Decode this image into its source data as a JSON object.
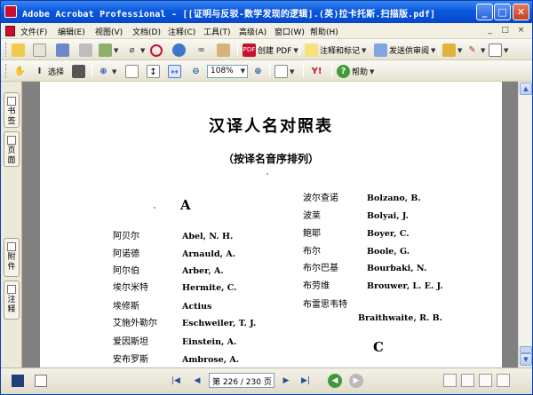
{
  "window": {
    "title": "Adobe Acrobat Professional - [[证明与反驳-数学发现的逻辑].(英)拉卡托斯.扫描版.pdf]",
    "controls": {
      "minimize": "_",
      "maximize": "□",
      "close": "✕"
    }
  },
  "menu": {
    "items": [
      "文件(F)",
      "编辑(E)",
      "视图(V)",
      "文档(D)",
      "注释(C)",
      "工具(T)",
      "高级(A)",
      "窗口(W)",
      "帮助(H)"
    ],
    "doc_controls": [
      "_",
      "□",
      "×"
    ]
  },
  "toolbar1": {
    "create_pdf": "创建 PDF",
    "comment_markup": "注释和标记",
    "send_review": "发送供审阅"
  },
  "toolbar2": {
    "select": "选择",
    "zoom_value": "108%",
    "help": "帮助"
  },
  "sidetabs": [
    "书签",
    "页面",
    "附件",
    "注释"
  ],
  "document": {
    "title": "汉译人名对照表",
    "subtitle": "（按译名音序排列）",
    "section_a": "A",
    "section_c": "C",
    "left_entries": [
      {
        "zh": "阿贝尔",
        "en": "Abel, N. H."
      },
      {
        "zh": "阿诺德",
        "en": "Arnauld, A."
      },
      {
        "zh": "阿尔伯",
        "en": "Arber, A."
      },
      {
        "zh": "埃尔米特",
        "en": "Hermite, C."
      },
      {
        "zh": "埃修斯",
        "en": "Actius"
      },
      {
        "zh": "艾施外勒尔",
        "en": "Eschweiler, T. J."
      },
      {
        "zh": "爱因斯坦",
        "en": "Einstein, A."
      },
      {
        "zh": "安布罗斯",
        "en": "Ambrose, A."
      }
    ],
    "right_entries": [
      {
        "zh": "波尔查诺",
        "en": "Bolzano, B."
      },
      {
        "zh": "波莱",
        "en": "Bolyai, J."
      },
      {
        "zh": "鲍耶",
        "en": "Boyer, C."
      },
      {
        "zh": "布尔",
        "en": "Boole, G."
      },
      {
        "zh": "布尔巴基",
        "en": "Bourbaki, N."
      },
      {
        "zh": "布劳维",
        "en": "Brouwer, L. E. J."
      },
      {
        "zh": "布雷思韦特",
        "en": ""
      }
    ],
    "indent_entry": "Braithwaite, R. B."
  },
  "status": {
    "page_display": "第 226 / 230 页",
    "nav": {
      "first": "|◀",
      "prev": "◀",
      "next": "▶",
      "last": "▶|"
    }
  },
  "colors": {
    "title_bar": "#0a58e0",
    "chrome": "#ece9d8",
    "doc_background": "#808080",
    "accent_red": "#c8102e"
  }
}
